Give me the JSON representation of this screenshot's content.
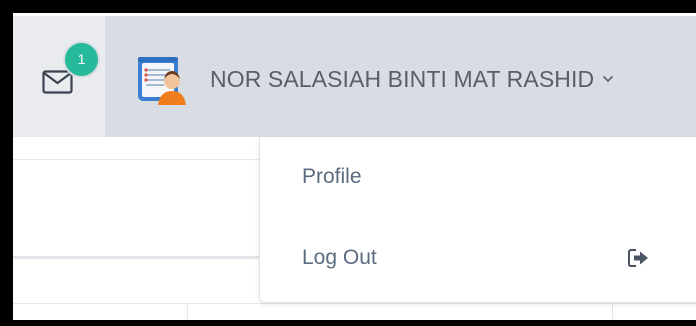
{
  "header": {
    "notifications": {
      "count": "1",
      "icon": "envelope-icon"
    },
    "user": {
      "name": "NOR SALASIAH BINTI MAT RASHID",
      "avatar": "user-avatar"
    }
  },
  "dropdown": {
    "items": [
      {
        "label": "Profile"
      },
      {
        "label": "Log Out",
        "icon": "sign-out-icon"
      }
    ]
  },
  "colors": {
    "topbar": "#d7dde3",
    "badge": "#26b99a",
    "text": "#5b6b7f"
  }
}
